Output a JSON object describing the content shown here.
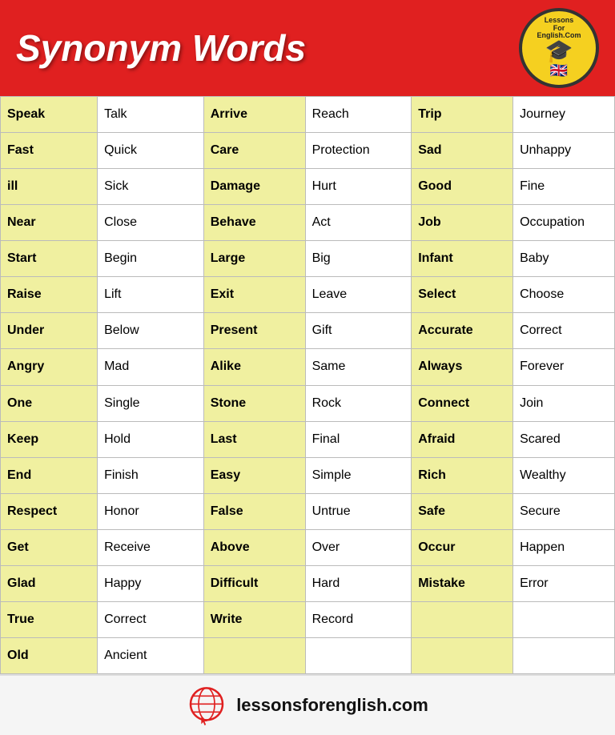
{
  "header": {
    "title": "Synonym Words",
    "logo_text_top": "LessonsForEnglish.Com",
    "logo_url": "lessonsforenglish.com"
  },
  "footer": {
    "url": "lessonsforenglish.com"
  },
  "columns": [
    {
      "pairs": [
        {
          "word": "Speak",
          "synonym": "Talk"
        },
        {
          "word": "Fast",
          "synonym": "Quick"
        },
        {
          "word": "ill",
          "synonym": "Sick"
        },
        {
          "word": "Near",
          "synonym": "Close"
        },
        {
          "word": "Start",
          "synonym": "Begin"
        },
        {
          "word": "Raise",
          "synonym": "Lift"
        },
        {
          "word": "Under",
          "synonym": "Below"
        },
        {
          "word": "Angry",
          "synonym": "Mad"
        },
        {
          "word": "One",
          "synonym": "Single"
        },
        {
          "word": "Keep",
          "synonym": "Hold"
        },
        {
          "word": "End",
          "synonym": "Finish"
        },
        {
          "word": "Respect",
          "synonym": "Honor"
        },
        {
          "word": "Get",
          "synonym": "Receive"
        },
        {
          "word": "Glad",
          "synonym": "Happy"
        },
        {
          "word": "True",
          "synonym": "Correct"
        },
        {
          "word": "Old",
          "synonym": "Ancient"
        }
      ]
    },
    {
      "pairs": [
        {
          "word": "Arrive",
          "synonym": "Reach"
        },
        {
          "word": "Care",
          "synonym": "Protection"
        },
        {
          "word": "Damage",
          "synonym": "Hurt"
        },
        {
          "word": "Behave",
          "synonym": "Act"
        },
        {
          "word": "Large",
          "synonym": "Big"
        },
        {
          "word": "Exit",
          "synonym": "Leave"
        },
        {
          "word": "Present",
          "synonym": "Gift"
        },
        {
          "word": "Alike",
          "synonym": "Same"
        },
        {
          "word": "Stone",
          "synonym": "Rock"
        },
        {
          "word": "Last",
          "synonym": "Final"
        },
        {
          "word": "Easy",
          "synonym": "Simple"
        },
        {
          "word": "False",
          "synonym": "Untrue"
        },
        {
          "word": "Above",
          "synonym": "Over"
        },
        {
          "word": "Difficult",
          "synonym": "Hard"
        },
        {
          "word": "Write",
          "synonym": "Record"
        }
      ]
    },
    {
      "pairs": [
        {
          "word": "Trip",
          "synonym": "Journey"
        },
        {
          "word": "Sad",
          "synonym": "Unhappy"
        },
        {
          "word": "Good",
          "synonym": "Fine"
        },
        {
          "word": "Job",
          "synonym": "Occupation"
        },
        {
          "word": "Infant",
          "synonym": "Baby"
        },
        {
          "word": "Select",
          "synonym": "Choose"
        },
        {
          "word": "Accurate",
          "synonym": "Correct"
        },
        {
          "word": "Always",
          "synonym": "Forever"
        },
        {
          "word": "Connect",
          "synonym": "Join"
        },
        {
          "word": "Afraid",
          "synonym": "Scared"
        },
        {
          "word": "Rich",
          "synonym": "Wealthy"
        },
        {
          "word": "Safe",
          "synonym": "Secure"
        },
        {
          "word": "Occur",
          "synonym": "Happen"
        },
        {
          "word": "Mistake",
          "synonym": "Error"
        }
      ]
    }
  ]
}
